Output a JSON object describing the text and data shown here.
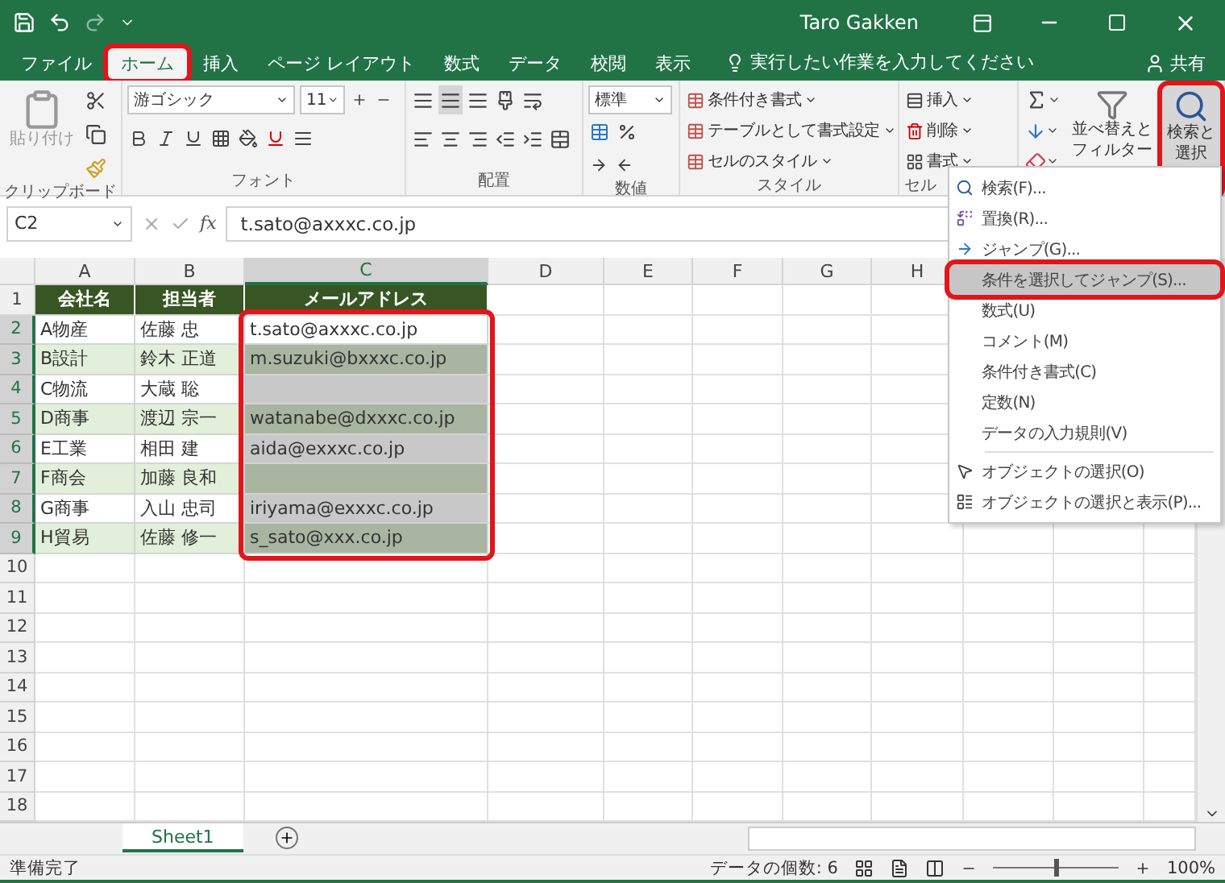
{
  "title_bar": {
    "user": "Taro Gakken"
  },
  "tabs": [
    {
      "label": "ファイル",
      "selected": false,
      "marked": false
    },
    {
      "label": "ホーム",
      "selected": true,
      "marked": true
    },
    {
      "label": "挿入",
      "selected": false,
      "marked": false
    },
    {
      "label": "ページ レイアウト",
      "selected": false,
      "marked": false
    },
    {
      "label": "数式",
      "selected": false,
      "marked": false
    },
    {
      "label": "データ",
      "selected": false,
      "marked": false
    },
    {
      "label": "校閲",
      "selected": false,
      "marked": false
    },
    {
      "label": "表示",
      "selected": false,
      "marked": false
    }
  ],
  "tell_me": {
    "placeholder": "実行したい作業を入力してください"
  },
  "share": "共有",
  "ribbon": {
    "clipboard": {
      "paste": "貼り付け",
      "label": "クリップボード"
    },
    "font": {
      "name": "游ゴシック",
      "size": "11",
      "label": "フォント"
    },
    "alignment": {
      "label": "配置"
    },
    "number": {
      "format": "標準",
      "label": "数値"
    },
    "styles": {
      "buttons": [
        "条件付き書式",
        "テーブルとして書式設定",
        "セルのスタイル"
      ],
      "label": "スタイル"
    },
    "cells": {
      "buttons": [
        "挿入",
        "削除",
        "書式"
      ],
      "label": "セル"
    },
    "editing": {
      "sort": [
        "並べ替えと",
        "フィルター"
      ],
      "find": {
        "lines": [
          "検索と",
          "選択"
        ],
        "marked": true
      }
    }
  },
  "menu": {
    "groups": [
      {
        "items": [
          {
            "kind": "find",
            "label": "検索(F)...",
            "selected": false
          },
          {
            "kind": "replace",
            "label": "置換(R)...",
            "selected": false
          },
          {
            "kind": "goto",
            "label": "ジャンプ(G)...",
            "selected": false
          },
          {
            "kind": "plain",
            "label": "条件を選択してジャンプ(S)...",
            "selected": true
          },
          {
            "kind": "plain",
            "label": "数式(U)",
            "selected": false
          },
          {
            "kind": "plain",
            "label": "コメント(M)",
            "selected": false
          },
          {
            "kind": "plain",
            "label": "条件付き書式(C)",
            "selected": false
          },
          {
            "kind": "plain",
            "label": "定数(N)",
            "selected": false
          },
          {
            "kind": "plain",
            "label": "データの入力規則(V)",
            "selected": false
          }
        ]
      },
      {
        "items": [
          {
            "kind": "pointer",
            "label": "オブジェクトの選択(O)",
            "selected": false
          },
          {
            "kind": "pane",
            "label": "オブジェクトの選択と表示(P)...",
            "selected": false
          }
        ]
      }
    ]
  },
  "formula_bar": {
    "name_box": "C2",
    "function_label": "fx",
    "value": "t.sato@axxxc.co.jp"
  },
  "sheet": {
    "selection_marked": true,
    "columns": [
      {
        "label": "A",
        "selected": false
      },
      {
        "label": "B",
        "selected": false
      },
      {
        "label": "C",
        "selected": true
      },
      {
        "label": "D",
        "selected": false
      },
      {
        "label": "E",
        "selected": false
      },
      {
        "label": "F",
        "selected": false
      },
      {
        "label": "G",
        "selected": false
      },
      {
        "label": "H",
        "selected": false
      }
    ],
    "rows": [
      {
        "number": "1",
        "kind": "header",
        "in_selection": false,
        "cells": [
          {
            "text": "会社名"
          },
          {
            "text": "担当者"
          },
          {
            "text": "メールアドレス"
          }
        ]
      },
      {
        "number": "2",
        "kind": "data",
        "in_selection": true,
        "banded": false,
        "cells": [
          {
            "text": "A物産",
            "shaded": false
          },
          {
            "text": "佐藤 忠",
            "shaded": false
          },
          {
            "text": "t.sato@axxxc.co.jp",
            "shaded": false
          }
        ]
      },
      {
        "number": "3",
        "kind": "data",
        "in_selection": true,
        "banded": true,
        "cells": [
          {
            "text": "B設計",
            "shaded": false
          },
          {
            "text": "鈴木 正道",
            "shaded": false
          },
          {
            "text": "m.suzuki@bxxxc.co.jp",
            "shaded": true
          }
        ]
      },
      {
        "number": "4",
        "kind": "data",
        "in_selection": true,
        "banded": false,
        "cells": [
          {
            "text": "C物流",
            "shaded": false
          },
          {
            "text": "大蔵 聡",
            "shaded": false
          },
          {
            "shaded": true
          }
        ]
      },
      {
        "number": "5",
        "kind": "data",
        "in_selection": true,
        "banded": true,
        "cells": [
          {
            "text": "D商事",
            "shaded": false
          },
          {
            "text": "渡辺 宗一",
            "shaded": false
          },
          {
            "text": "watanabe@dxxxc.co.jp",
            "shaded": true
          }
        ]
      },
      {
        "number": "6",
        "kind": "data",
        "in_selection": true,
        "banded": false,
        "cells": [
          {
            "text": "E工業",
            "shaded": false
          },
          {
            "text": "相田 建",
            "shaded": false
          },
          {
            "text": "aida@exxxc.co.jp",
            "shaded": true
          }
        ]
      },
      {
        "number": "7",
        "kind": "data",
        "in_selection": true,
        "banded": true,
        "cells": [
          {
            "text": "F商会",
            "shaded": false
          },
          {
            "text": "加藤 良和",
            "shaded": false
          },
          {
            "shaded": true
          }
        ]
      },
      {
        "number": "8",
        "kind": "data",
        "in_selection": true,
        "banded": false,
        "cells": [
          {
            "text": "G商事",
            "shaded": false
          },
          {
            "text": "入山 忠司",
            "shaded": false
          },
          {
            "text": "iriyama@exxxc.co.jp",
            "shaded": true
          }
        ]
      },
      {
        "number": "9",
        "kind": "data",
        "in_selection": true,
        "banded": true,
        "cells": [
          {
            "text": "H貿易",
            "shaded": false
          },
          {
            "text": "佐藤 修一",
            "shaded": false
          },
          {
            "text": "s_sato@xxx.co.jp",
            "shaded": true
          }
        ]
      },
      {
        "number": "10",
        "kind": "empty",
        "in_selection": false
      },
      {
        "number": "11",
        "kind": "empty",
        "in_selection": false
      },
      {
        "number": "12",
        "kind": "empty",
        "in_selection": false
      },
      {
        "number": "13",
        "kind": "empty",
        "in_selection": false
      },
      {
        "number": "14",
        "kind": "empty",
        "in_selection": false
      },
      {
        "number": "15",
        "kind": "empty",
        "in_selection": false
      },
      {
        "number": "16",
        "kind": "empty",
        "in_selection": false
      },
      {
        "number": "17",
        "kind": "empty",
        "in_selection": false
      },
      {
        "number": "18",
        "kind": "empty",
        "in_selection": false
      }
    ]
  },
  "sheet_tabs": [
    {
      "label": "Sheet1",
      "selected": true
    }
  ],
  "status_bar": {
    "status": "準備完了",
    "count": "データの個数: 6",
    "zoom": {
      "level": 0.5,
      "reading": "100%"
    }
  }
}
